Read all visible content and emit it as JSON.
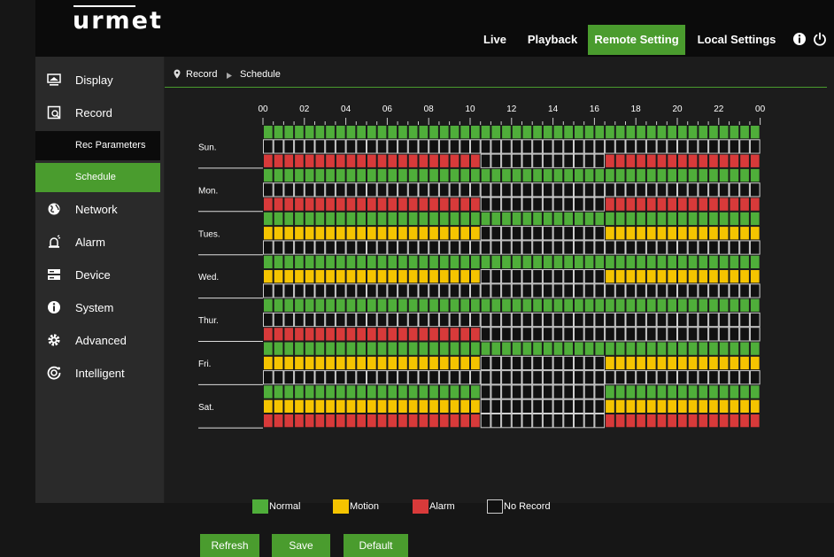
{
  "brand": {
    "logo": "urmet"
  },
  "nav": {
    "live": "Live",
    "playback": "Playback",
    "remote_setting": "Remote Setting",
    "local_settings": "Local Settings"
  },
  "icons": {
    "info": "info-icon",
    "power": "power-icon"
  },
  "sidebar": {
    "display": "Display",
    "record": "Record",
    "rec_parameters": "Rec Parameters",
    "schedule": "Schedule",
    "network": "Network",
    "alarm": "Alarm",
    "device": "Device",
    "system": "System",
    "advanced": "Advanced",
    "intelligent": "Intelligent"
  },
  "breadcrumb": {
    "root": "Record",
    "current": "Schedule"
  },
  "schedule": {
    "hours": [
      "00",
      "02",
      "04",
      "06",
      "08",
      "10",
      "12",
      "14",
      "16",
      "18",
      "20",
      "22",
      "00"
    ],
    "days": [
      {
        "label": "Sun.",
        "rows": [
          "G",
          "B",
          "RRRRRRRRRRRRRRRRRRRRRBBBBBBBBBBBBRRRRRRRRRRRRRRR"
        ]
      },
      {
        "label": "Mon.",
        "rows": [
          "G",
          "B",
          "RRRRRRRRRRRRRRRRRRRRRBBBBBBBBBBBBRRRRRRRRRRRRRRR"
        ]
      },
      {
        "label": "Tues.",
        "rows": [
          "G",
          "YYYYYYYYYYYYYYYYYYYYYBBBBBBBBBBBBYYYYYYYYYYYYYYY",
          "B"
        ]
      },
      {
        "label": "Wed.",
        "rows": [
          "G",
          "YYYYYYYYYYYYYYYYYYYYYBBBBBBBBBBBBYYYYYYYYYYYYYYY",
          "B"
        ]
      },
      {
        "label": "Thur.",
        "rows": [
          "G",
          "B",
          "RRRRRRRRRRRRRRRRRRRRRBBBBBBBBBBBBBBBBBBBBBBBBBBB"
        ]
      },
      {
        "label": "Fri.",
        "rows": [
          "G",
          "YYYYYYYYYYYYYYYYYYYYYBBBBBBBBBBBBYYYYYYYYYYYYYYY",
          "B"
        ]
      },
      {
        "label": "Sat.",
        "rows": [
          "GGGGGGGGGGGGGGGGGGGGGBBBBBBBBBBBBGGGGGGGGGGGGGGG",
          "YYYYYYYYYYYYYYYYYYYYYBBBBBBBBBBBBYYYYYYYYYYYYYYY",
          "RRRRRRRRRRRRRRRRRRRRRBBBBBBBBBBBBRRRRRRRRRRRRRRR"
        ]
      }
    ]
  },
  "legend": {
    "normal": "Normal",
    "motion": "Motion",
    "alarm": "Alarm",
    "no_record": "No Record"
  },
  "colors": {
    "normal": "#4fae3a",
    "motion": "#f5c400",
    "alarm": "#d83a3a",
    "no_record": "#111111",
    "accent": "#4a9c2e"
  },
  "buttons": {
    "refresh": "Refresh",
    "save": "Save",
    "default": "Default"
  }
}
